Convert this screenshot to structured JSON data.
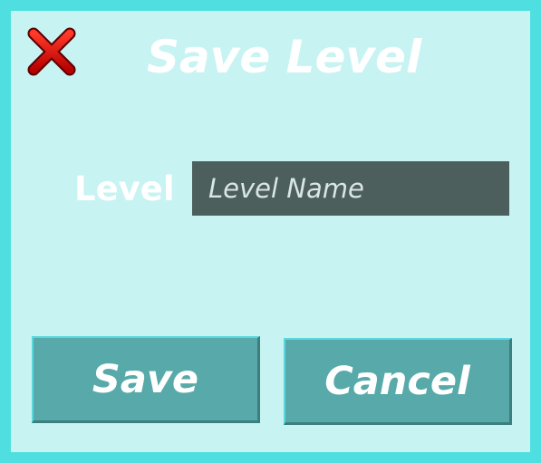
{
  "dialog": {
    "title": "Save Level",
    "close_icon": "close-x-icon",
    "field_label": "Level",
    "level_input": {
      "value": "",
      "placeholder": "Level Name"
    },
    "save_label": "Save",
    "cancel_label": "Cancel"
  },
  "colors": {
    "frame": "#4fdfe0",
    "panel": "#c8f3f3",
    "input_bg": "#4c5f5d",
    "button_bg": "#57aaa9",
    "close_icon": "#d60000",
    "text": "#ffffff"
  }
}
